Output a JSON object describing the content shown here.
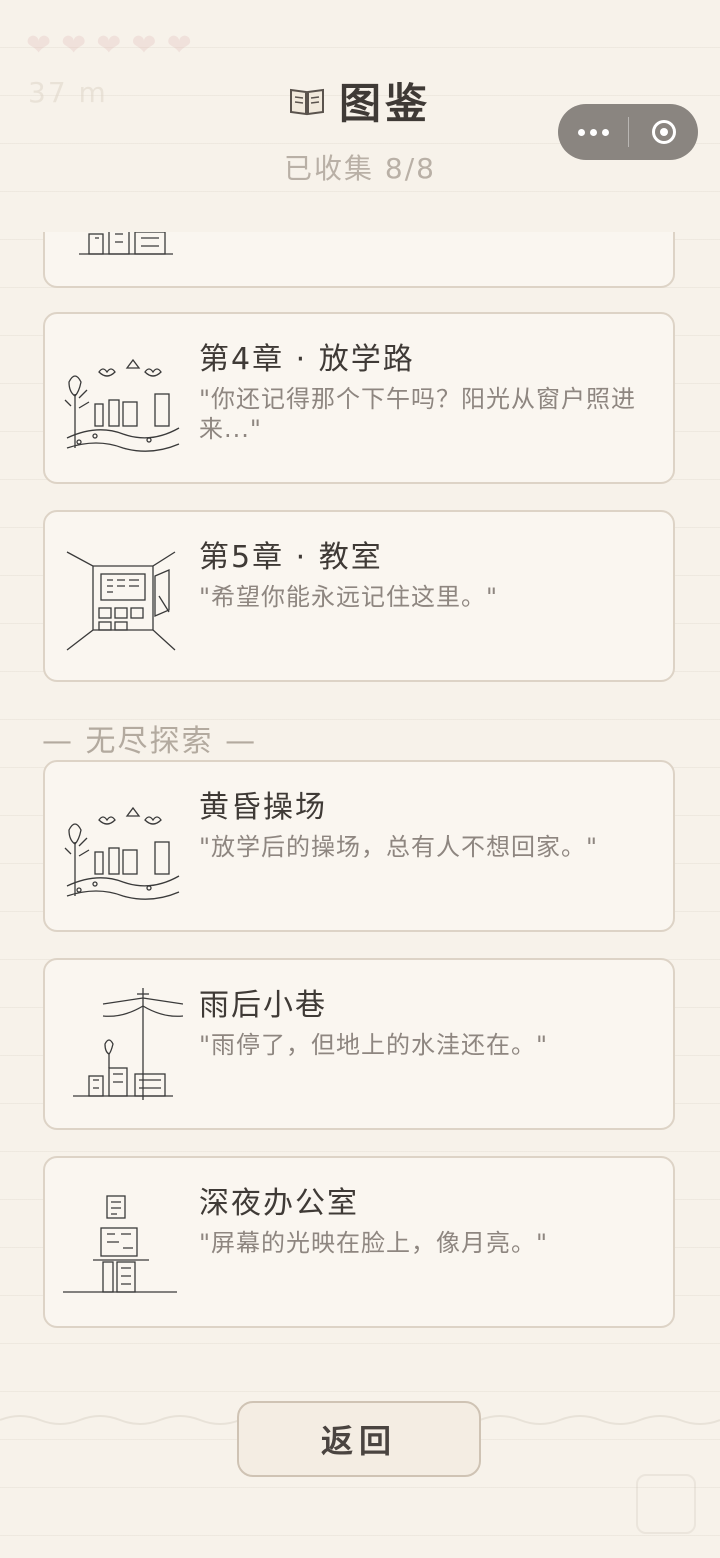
{
  "header": {
    "title": "图鉴",
    "subtitle": "已收集 8/8",
    "book_icon": "book-icon"
  },
  "ghost_hud": {
    "hearts": [
      "❤",
      "❤",
      "❤",
      "❤",
      "❤"
    ],
    "distance": "37 m"
  },
  "capsule": {
    "more_icon": "more-dots-icon",
    "close_icon": "close-circle-icon"
  },
  "cards": [
    {
      "name": "第4章 · 放学路",
      "quote": "\"你还记得那个下午吗？阳光从窗户照进来...\"",
      "icon": "schoolyard-sketch-icon"
    },
    {
      "name": "第5章 · 教室",
      "quote": "\"希望你能永远记住这里。\"",
      "icon": "classroom-sketch-icon"
    }
  ],
  "section": {
    "label": "— 无尽探索 —"
  },
  "endless_cards": [
    {
      "name": "黄昏操场",
      "quote": "\"放学后的操场，总有人不想回家。\"",
      "icon": "playground-sketch-icon"
    },
    {
      "name": "雨后小巷",
      "quote": "\"雨停了，但地上的水洼还在。\"",
      "icon": "alley-sketch-icon"
    },
    {
      "name": "深夜办公室",
      "quote": "\"屏幕的光映在脸上，像月亮。\"",
      "icon": "office-sketch-icon"
    }
  ],
  "footer": {
    "back_label": "返回"
  },
  "colors": {
    "background": "#f7f2ea",
    "card_border": "#ddd3c6",
    "card_bg": "#faf6f0",
    "title": "#3f3a36",
    "muted": "#b9b0a6"
  }
}
